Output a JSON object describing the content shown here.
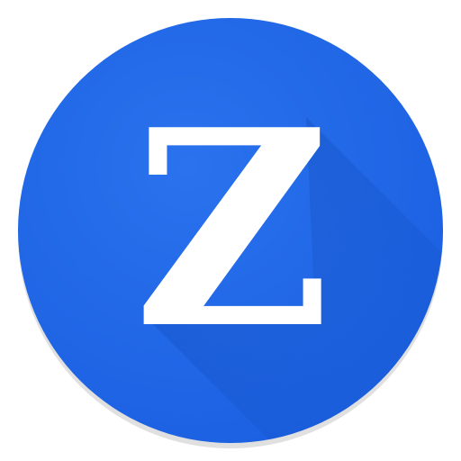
{
  "icon": {
    "letter": "Z",
    "circle_color": "#1e66e6",
    "shadow_color": "#0b3fa8",
    "letter_color": "#ffffff",
    "name": "z-app-icon"
  }
}
